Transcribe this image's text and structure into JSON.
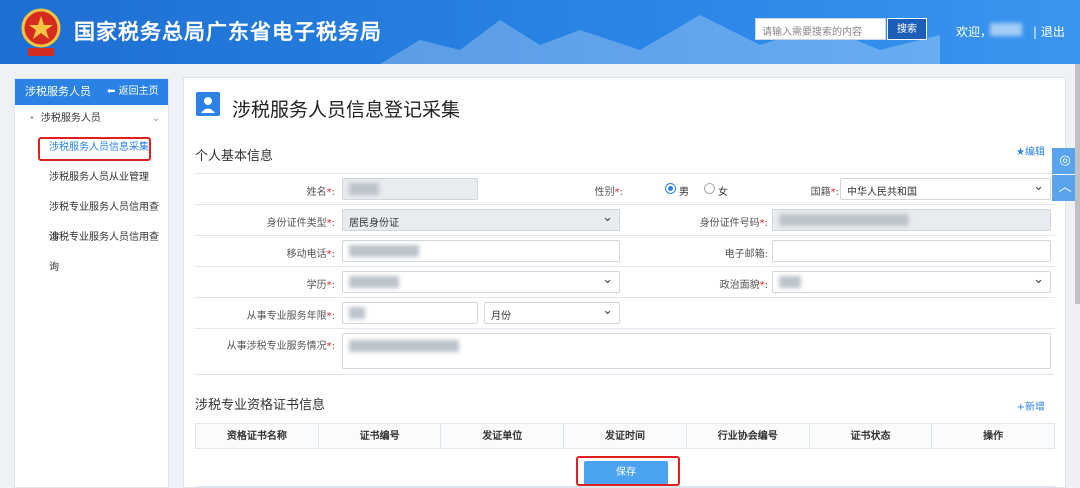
{
  "header": {
    "title": "国家税务总局广东省电子税务局",
    "search_placeholder": "请输入需要搜索的内容",
    "search_button": "搜索",
    "welcome": "欢迎，",
    "separator": "|",
    "logout": "退出",
    "brand_color": "#2a86e6"
  },
  "sidebar": {
    "head": "涉税服务人员",
    "back": "返回主页",
    "group": "涉税服务人员",
    "items": [
      {
        "label": "涉税服务人员信息采集"
      },
      {
        "label": "涉税服务人员从业管理"
      },
      {
        "label": "涉税专业服务人员信用查询"
      },
      {
        "label": "涉税专业服务人员信用查询"
      }
    ]
  },
  "main": {
    "page_title": "涉税服务人员信息登记采集",
    "basic_section": "个人基本信息",
    "edit_link": "编辑",
    "form": {
      "name_label": "姓名",
      "gender_label": "性别",
      "gender_male": "男",
      "gender_female": "女",
      "nationality_label": "国籍",
      "nationality_value": "中华人民共和国",
      "id_type_label": "身份证件类型",
      "id_type_value": "居民身份证",
      "id_no_label": "身份证件号码",
      "mobile_label": "移动电话",
      "email_label": "电子邮箱",
      "education_label": "学历",
      "political_label": "政治面貌",
      "years_label": "从事专业服务年限",
      "month_value": "月份",
      "experience_label": "从事涉税专业服务情况",
      "required_mark": "*",
      "colon": ":"
    },
    "cert_section": "涉税专业资格证书信息",
    "add_link": "新增",
    "table_headers": [
      "资格证书名称",
      "证书编号",
      "发证单位",
      "发证时间",
      "行业协会编号",
      "证书状态",
      "操作"
    ],
    "save_button": "保存"
  }
}
